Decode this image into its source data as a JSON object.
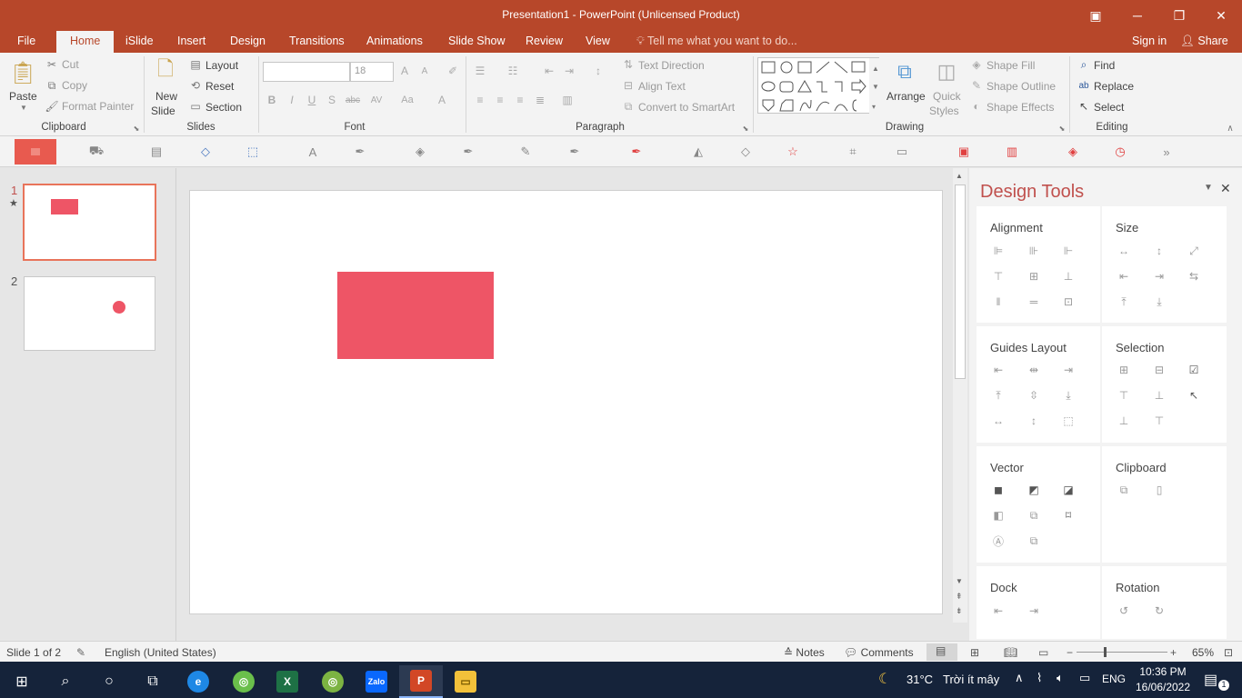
{
  "window": {
    "title": "Presentation1 - PowerPoint (Unlicensed Product)",
    "minimize_icon": "minimize-icon",
    "restore_icon": "restore-icon",
    "close_icon": "close-icon"
  },
  "tabs": [
    "File",
    "Home",
    "iSlide",
    "Insert",
    "Design",
    "Transitions",
    "Animations",
    "Slide Show",
    "Review",
    "View"
  ],
  "active_tab": "Home",
  "tell_me": "Tell me what you want to do...",
  "sign_in": "Sign in",
  "share": "Share",
  "ribbon": {
    "clipboard": {
      "paste": "Paste",
      "cut": "Cut",
      "copy": "Copy",
      "format_painter": "Format Painter",
      "label": "Clipboard"
    },
    "slides": {
      "new_slide_1": "New",
      "new_slide_2": "Slide",
      "layout": "Layout",
      "reset": "Reset",
      "section": "Section",
      "label": "Slides"
    },
    "font": {
      "font_name": "",
      "font_size": "18",
      "label": "Font"
    },
    "paragraph": {
      "text_direction": "Text Direction",
      "align_text": "Align Text",
      "convert_smartart": "Convert to SmartArt",
      "label": "Paragraph"
    },
    "drawing": {
      "arrange": "Arrange",
      "quick_styles_1": "Quick",
      "quick_styles_2": "Styles",
      "shape_fill": "Shape Fill",
      "shape_outline": "Shape Outline",
      "shape_effects": "Shape Effects",
      "label": "Drawing"
    },
    "editing": {
      "find": "Find",
      "replace": "Replace",
      "select": "Select",
      "label": "Editing"
    }
  },
  "thumbnails": [
    {
      "number": "1",
      "star": "★"
    },
    {
      "number": "2",
      "star": ""
    }
  ],
  "design_tools": {
    "title": "Design Tools",
    "sections": {
      "alignment": "Alignment",
      "size": "Size",
      "guides_layout": "Guides Layout",
      "selection": "Selection",
      "vector": "Vector",
      "clipboard": "Clipboard",
      "dock": "Dock",
      "rotation": "Rotation"
    }
  },
  "slide_shapes": {
    "rect_color": "#ee5566",
    "circle_color": "#ee5566"
  },
  "status": {
    "slide_of": "Slide 1 of 2",
    "language": "English (United States)",
    "notes": "Notes",
    "comments": "Comments",
    "zoom": "65%"
  },
  "taskbar": {
    "weather_temp": "31°C",
    "weather_text": "Trời ít mây",
    "lang": "ENG",
    "time": "10:36 PM",
    "date": "16/06/2022",
    "notification_count": "1",
    "zalo": "Zalo"
  }
}
